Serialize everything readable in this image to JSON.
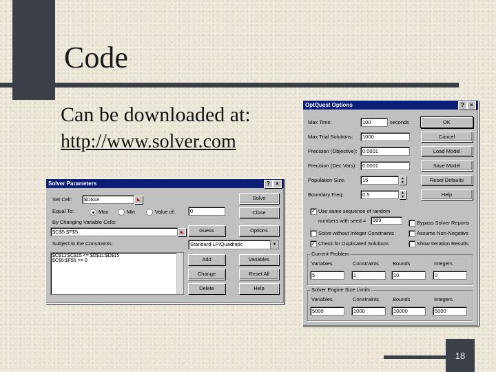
{
  "slide": {
    "title": "Code",
    "subtitle": "Can be downloaded at:",
    "url": "http://www.solver.com",
    "page_number": "18"
  },
  "solver": {
    "title": "Solver Parameters",
    "help_icon": "?",
    "close_icon": "×",
    "set_cell_label": "Set Cell:",
    "set_cell_value": "$D$18",
    "equal_to_label": "Equal To:",
    "opt_max": "Max",
    "opt_min": "Min",
    "opt_value": "Value of:",
    "value_of_field": "0",
    "by_changing_label": "By Changing Variable Cells:",
    "by_changing_value": "$C$5:$F$5",
    "subject_label": "Subject to the Constraints:",
    "engine_select": "Standard LP/Quadratic",
    "constraints": [
      "$C$11:$C$15 <= $D$11:$D$15",
      "$C$5:$F$5 >= 0"
    ],
    "buttons": {
      "solve": "Solve",
      "close": "Close",
      "guess": "Guess",
      "options": "Options",
      "add": "Add",
      "variables": "Variables",
      "change": "Change",
      "reset_all": "Reset All",
      "delete": "Delete",
      "help": "Help"
    }
  },
  "optquest": {
    "title": "OptQuest Options",
    "help_icon": "?",
    "close_icon": "×",
    "max_time_label": "Max Time:",
    "max_time_value": "100",
    "max_time_unit": "seconds",
    "max_subproblems_label": "Max Trial Solutions:",
    "max_subproblems_value": "1000",
    "precision_obj_label": "Precision (Objective):",
    "precision_obj_value": "0.0001",
    "precision_dec_label": "Precision (Dec Vars):",
    "precision_dec_value": "0.0001",
    "population_label": "Population Size:",
    "population_value": "15",
    "boundary_label": "Boundary Freq:",
    "boundary_value": "0.5",
    "seq_label": "Use same sequence of random",
    "seed_label": "numbers with seed =",
    "seed_value": "999",
    "solve_wo_int": "Solve without Integer Constraints",
    "check_dup": "Check for Duplicated Solutions",
    "bypass_reports": "Bypass Solver Reports",
    "assume_nonneg": "Assume Non-Negative",
    "show_iter": "Show Iteration Results",
    "buttons": {
      "ok": "OK",
      "cancel": "Cancel",
      "load_model": "Load Model",
      "save_model": "Save Model",
      "reset_defaults": "Reset Defaults",
      "help": "Help"
    },
    "current_problem": {
      "label": "Current Problem",
      "headers": [
        "Variables",
        "Constraints",
        "Bounds",
        "Integers"
      ],
      "values": [
        "5",
        "1",
        "10",
        "0"
      ]
    },
    "limits": {
      "label": "Solver Engine Size Limits",
      "headers": [
        "Variables",
        "Constraints",
        "Bounds",
        "Integers"
      ],
      "values": [
        "5000",
        "1000",
        "10000",
        "5000"
      ]
    }
  }
}
